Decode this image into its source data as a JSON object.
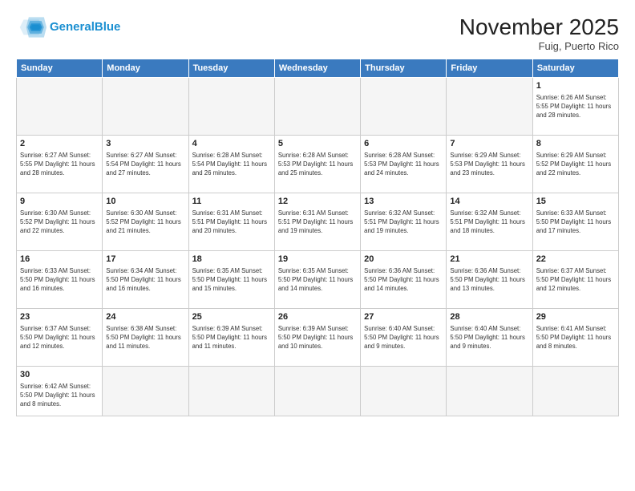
{
  "header": {
    "logo_general": "General",
    "logo_blue": "Blue",
    "month_title": "November 2025",
    "location": "Fuig, Puerto Rico"
  },
  "weekdays": [
    "Sunday",
    "Monday",
    "Tuesday",
    "Wednesday",
    "Thursday",
    "Friday",
    "Saturday"
  ],
  "weeks": [
    [
      {
        "day": "",
        "info": ""
      },
      {
        "day": "",
        "info": ""
      },
      {
        "day": "",
        "info": ""
      },
      {
        "day": "",
        "info": ""
      },
      {
        "day": "",
        "info": ""
      },
      {
        "day": "",
        "info": ""
      },
      {
        "day": "1",
        "info": "Sunrise: 6:26 AM\nSunset: 5:55 PM\nDaylight: 11 hours\nand 28 minutes."
      }
    ],
    [
      {
        "day": "2",
        "info": "Sunrise: 6:27 AM\nSunset: 5:55 PM\nDaylight: 11 hours\nand 28 minutes."
      },
      {
        "day": "3",
        "info": "Sunrise: 6:27 AM\nSunset: 5:54 PM\nDaylight: 11 hours\nand 27 minutes."
      },
      {
        "day": "4",
        "info": "Sunrise: 6:28 AM\nSunset: 5:54 PM\nDaylight: 11 hours\nand 26 minutes."
      },
      {
        "day": "5",
        "info": "Sunrise: 6:28 AM\nSunset: 5:53 PM\nDaylight: 11 hours\nand 25 minutes."
      },
      {
        "day": "6",
        "info": "Sunrise: 6:28 AM\nSunset: 5:53 PM\nDaylight: 11 hours\nand 24 minutes."
      },
      {
        "day": "7",
        "info": "Sunrise: 6:29 AM\nSunset: 5:53 PM\nDaylight: 11 hours\nand 23 minutes."
      },
      {
        "day": "8",
        "info": "Sunrise: 6:29 AM\nSunset: 5:52 PM\nDaylight: 11 hours\nand 22 minutes."
      }
    ],
    [
      {
        "day": "9",
        "info": "Sunrise: 6:30 AM\nSunset: 5:52 PM\nDaylight: 11 hours\nand 22 minutes."
      },
      {
        "day": "10",
        "info": "Sunrise: 6:30 AM\nSunset: 5:52 PM\nDaylight: 11 hours\nand 21 minutes."
      },
      {
        "day": "11",
        "info": "Sunrise: 6:31 AM\nSunset: 5:51 PM\nDaylight: 11 hours\nand 20 minutes."
      },
      {
        "day": "12",
        "info": "Sunrise: 6:31 AM\nSunset: 5:51 PM\nDaylight: 11 hours\nand 19 minutes."
      },
      {
        "day": "13",
        "info": "Sunrise: 6:32 AM\nSunset: 5:51 PM\nDaylight: 11 hours\nand 19 minutes."
      },
      {
        "day": "14",
        "info": "Sunrise: 6:32 AM\nSunset: 5:51 PM\nDaylight: 11 hours\nand 18 minutes."
      },
      {
        "day": "15",
        "info": "Sunrise: 6:33 AM\nSunset: 5:50 PM\nDaylight: 11 hours\nand 17 minutes."
      }
    ],
    [
      {
        "day": "16",
        "info": "Sunrise: 6:33 AM\nSunset: 5:50 PM\nDaylight: 11 hours\nand 16 minutes."
      },
      {
        "day": "17",
        "info": "Sunrise: 6:34 AM\nSunset: 5:50 PM\nDaylight: 11 hours\nand 16 minutes."
      },
      {
        "day": "18",
        "info": "Sunrise: 6:35 AM\nSunset: 5:50 PM\nDaylight: 11 hours\nand 15 minutes."
      },
      {
        "day": "19",
        "info": "Sunrise: 6:35 AM\nSunset: 5:50 PM\nDaylight: 11 hours\nand 14 minutes."
      },
      {
        "day": "20",
        "info": "Sunrise: 6:36 AM\nSunset: 5:50 PM\nDaylight: 11 hours\nand 14 minutes."
      },
      {
        "day": "21",
        "info": "Sunrise: 6:36 AM\nSunset: 5:50 PM\nDaylight: 11 hours\nand 13 minutes."
      },
      {
        "day": "22",
        "info": "Sunrise: 6:37 AM\nSunset: 5:50 PM\nDaylight: 11 hours\nand 12 minutes."
      }
    ],
    [
      {
        "day": "23",
        "info": "Sunrise: 6:37 AM\nSunset: 5:50 PM\nDaylight: 11 hours\nand 12 minutes."
      },
      {
        "day": "24",
        "info": "Sunrise: 6:38 AM\nSunset: 5:50 PM\nDaylight: 11 hours\nand 11 minutes."
      },
      {
        "day": "25",
        "info": "Sunrise: 6:39 AM\nSunset: 5:50 PM\nDaylight: 11 hours\nand 11 minutes."
      },
      {
        "day": "26",
        "info": "Sunrise: 6:39 AM\nSunset: 5:50 PM\nDaylight: 11 hours\nand 10 minutes."
      },
      {
        "day": "27",
        "info": "Sunrise: 6:40 AM\nSunset: 5:50 PM\nDaylight: 11 hours\nand 9 minutes."
      },
      {
        "day": "28",
        "info": "Sunrise: 6:40 AM\nSunset: 5:50 PM\nDaylight: 11 hours\nand 9 minutes."
      },
      {
        "day": "29",
        "info": "Sunrise: 6:41 AM\nSunset: 5:50 PM\nDaylight: 11 hours\nand 8 minutes."
      }
    ],
    [
      {
        "day": "30",
        "info": "Sunrise: 6:42 AM\nSunset: 5:50 PM\nDaylight: 11 hours\nand 8 minutes."
      },
      {
        "day": "",
        "info": ""
      },
      {
        "day": "",
        "info": ""
      },
      {
        "day": "",
        "info": ""
      },
      {
        "day": "",
        "info": ""
      },
      {
        "day": "",
        "info": ""
      },
      {
        "day": "",
        "info": ""
      }
    ]
  ]
}
